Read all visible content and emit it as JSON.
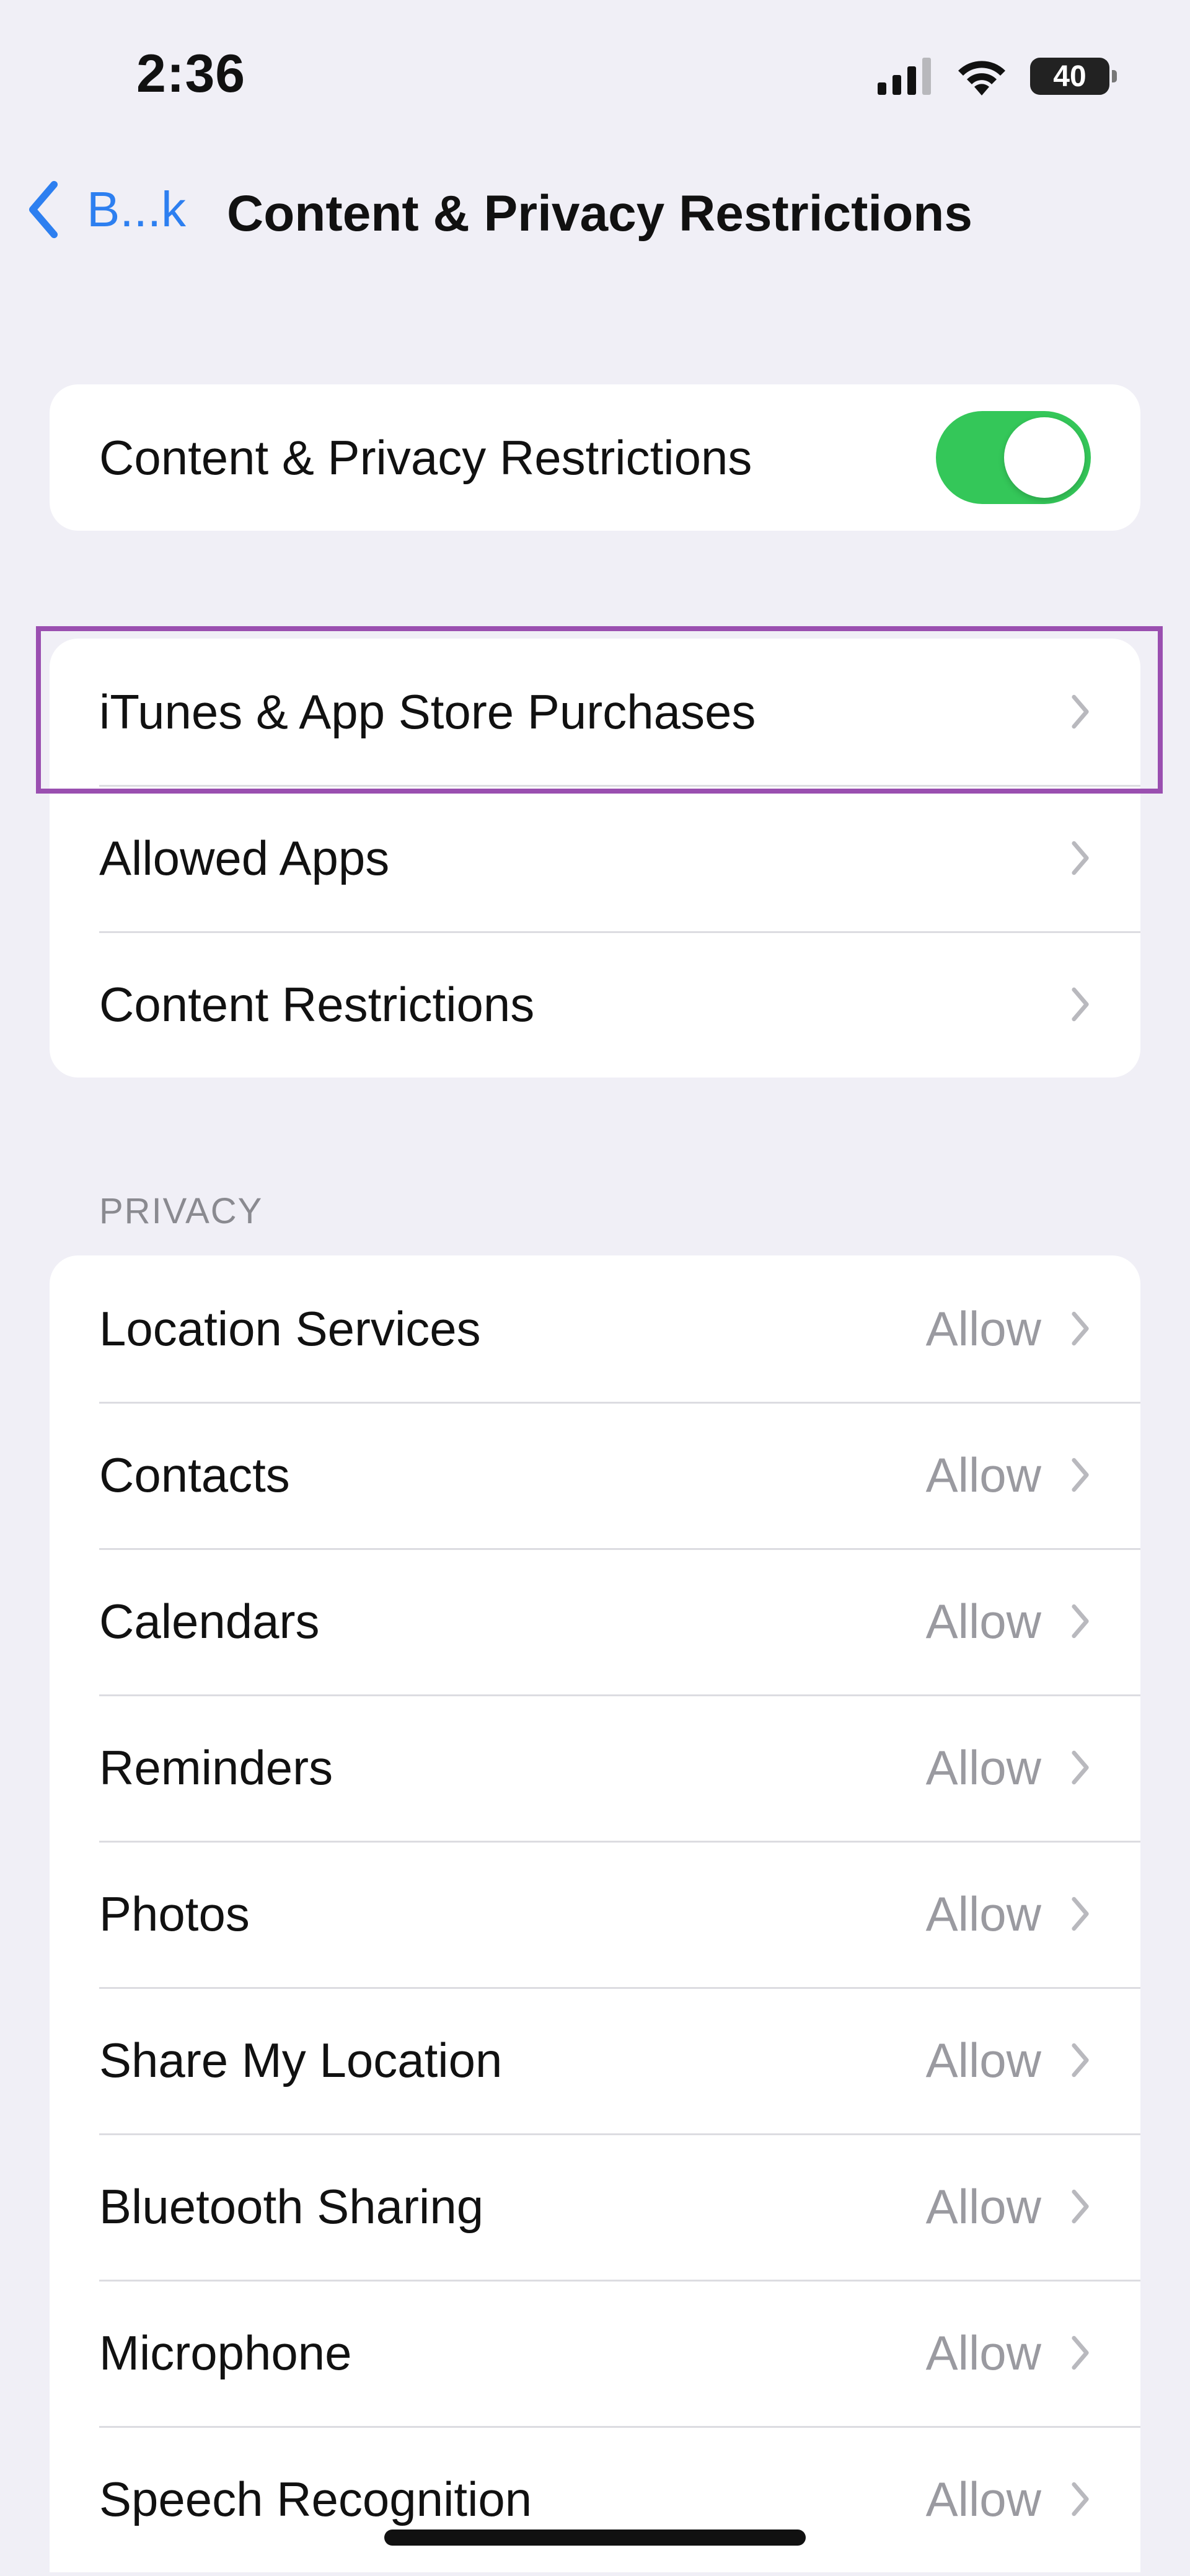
{
  "status_bar": {
    "time": "2:36",
    "battery": "40",
    "icons": [
      "signal-icon",
      "wifi-icon",
      "battery-icon"
    ]
  },
  "nav": {
    "back_label": "B...k",
    "title": "Content & Privacy Restrictions"
  },
  "master_toggle": {
    "label": "Content & Privacy Restrictions",
    "on": true,
    "color": "#34c759"
  },
  "store_group": {
    "items": [
      {
        "label": "iTunes & App Store Purchases",
        "highlighted": true
      },
      {
        "label": "Allowed Apps"
      },
      {
        "label": "Content Restrictions"
      }
    ]
  },
  "privacy": {
    "header": "PRIVACY",
    "items": [
      {
        "label": "Location Services",
        "value": "Allow"
      },
      {
        "label": "Contacts",
        "value": "Allow"
      },
      {
        "label": "Calendars",
        "value": "Allow"
      },
      {
        "label": "Reminders",
        "value": "Allow"
      },
      {
        "label": "Photos",
        "value": "Allow"
      },
      {
        "label": "Share My Location",
        "value": "Allow"
      },
      {
        "label": "Bluetooth Sharing",
        "value": "Allow"
      },
      {
        "label": "Microphone",
        "value": "Allow"
      },
      {
        "label": "Speech Recognition",
        "value": "Allow"
      }
    ]
  },
  "colors": {
    "accent": "#2d7ff0",
    "highlight": "#9a4fb0",
    "background": "#f0eff6"
  }
}
